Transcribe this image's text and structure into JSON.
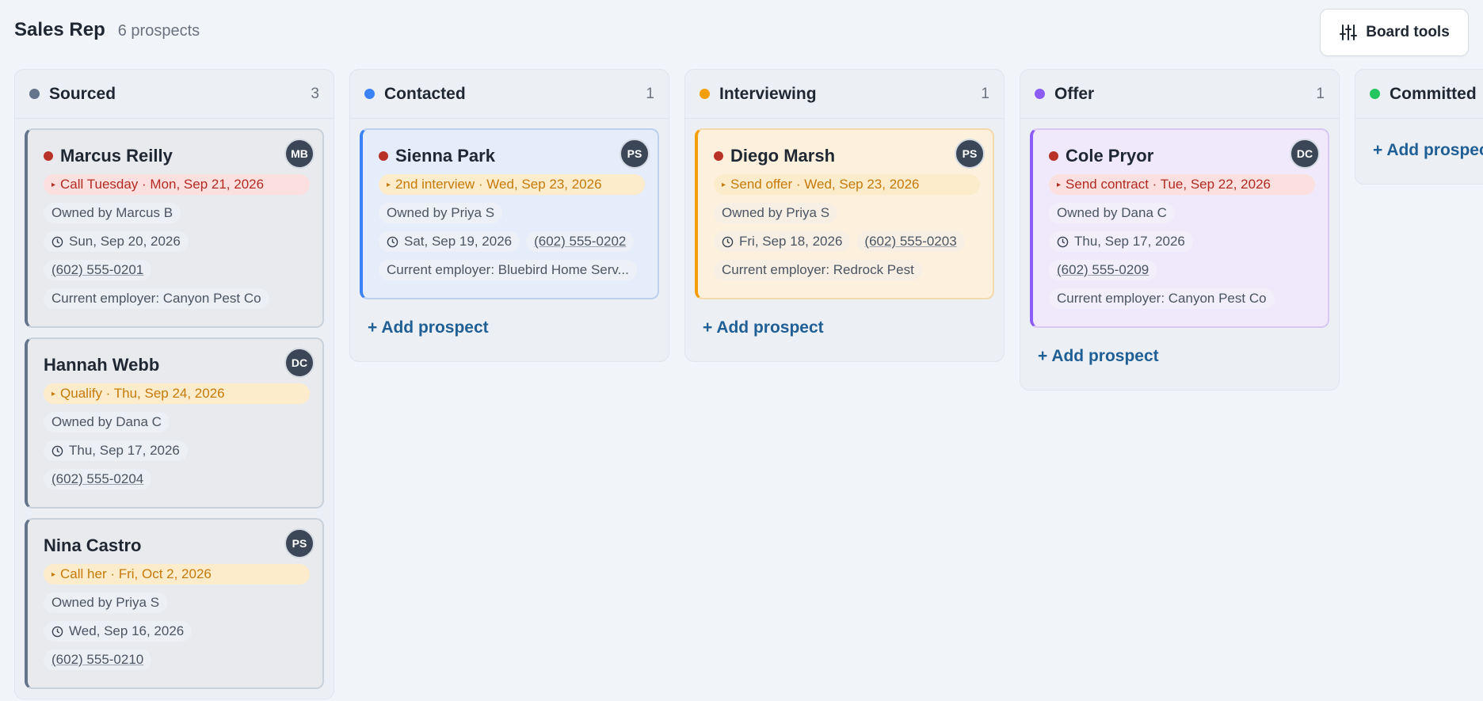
{
  "header": {
    "title": "Sales Rep",
    "subtitle": "6 prospects",
    "board_tools_label": "Board tools"
  },
  "columns": [
    {
      "title": "Sourced",
      "count": "3",
      "color": "#64748b",
      "cards": [
        {
          "name": "Marcus Reilly",
          "avatar": "MB",
          "task": "Call Tuesday · Mon, Sep 21, 2026",
          "owner": "Owned by Marcus B",
          "date": "Sun, Sep 20, 2026",
          "phone": "(602) 555-0201",
          "employer": "Current employer: Canyon Pest Co"
        },
        {
          "name": "Hannah Webb",
          "avatar": "DC",
          "task": "Qualify · Thu, Sep 24, 2026",
          "owner": "Owned by Dana C",
          "date": "Thu, Sep 17, 2026",
          "phone": "(602) 555-0204"
        },
        {
          "name": "Nina Castro",
          "avatar": "PS",
          "task": "Call her · Fri, Oct 2, 2026",
          "owner": "Owned by Priya S",
          "date": "Wed, Sep 16, 2026",
          "phone": "(602) 555-0210"
        }
      ]
    },
    {
      "title": "Contacted",
      "count": "1",
      "color": "#3b82f6",
      "cards": [
        {
          "name": "Sienna Park",
          "avatar": "PS",
          "task": "2nd interview · Wed, Sep 23, 2026",
          "owner": "Owned by Priya S",
          "date": "Sat, Sep 19, 2026",
          "phone": "(602) 555-0202",
          "employer": "Current employer: Bluebird Home Serv..."
        }
      ],
      "add_label": "+ Add prospect"
    },
    {
      "title": "Interviewing",
      "count": "1",
      "color": "#f59e0b",
      "cards": [
        {
          "name": "Diego Marsh",
          "avatar": "PS",
          "task": "Send offer · Wed, Sep 23, 2026",
          "owner": "Owned by Priya S",
          "date": "Fri, Sep 18, 2026",
          "phone": "(602) 555-0203",
          "employer": "Current employer: Redrock Pest"
        }
      ],
      "add_label": "+ Add prospect"
    },
    {
      "title": "Offer",
      "count": "1",
      "color": "#8b5cf6",
      "cards": [
        {
          "name": "Cole Pryor",
          "avatar": "DC",
          "task": "Send contract · Tue, Sep 22, 2026",
          "owner": "Owned by Dana C",
          "date": "Thu, Sep 17, 2026",
          "phone": "(602) 555-0209",
          "employer": "Current employer: Canyon Pest Co"
        }
      ],
      "add_label": "+ Add prospect"
    },
    {
      "title": "Committed",
      "color": "#22c55e",
      "add_label": "+ Add prospect"
    }
  ]
}
